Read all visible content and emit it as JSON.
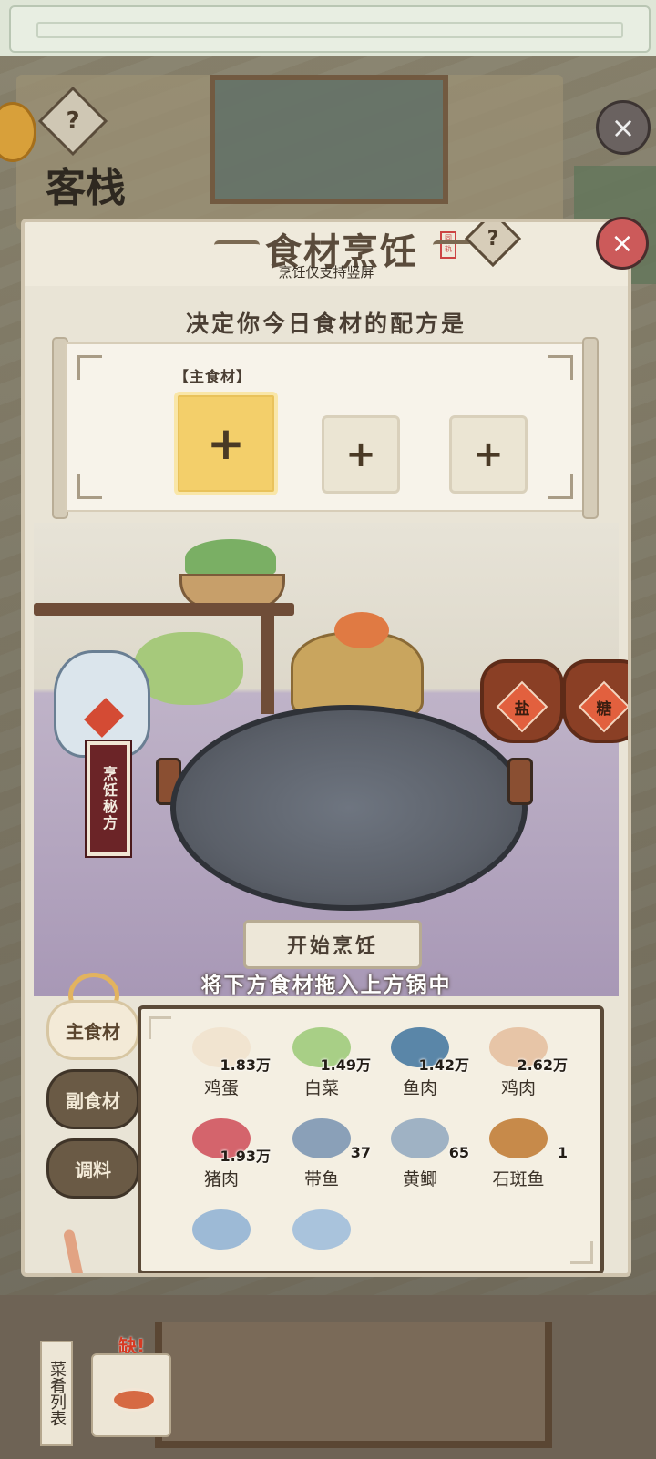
{
  "background": {
    "title": "客栈"
  },
  "panel": {
    "title": "食材烹饪",
    "title_seal": "同轨",
    "subnote": "烹饪仅支持竖屏",
    "prompt": "决定你今日食材的配方是",
    "main_label": "【主食材】",
    "slot_plus": "+",
    "secret_recipe": "烹饪秘方",
    "start_button": "开始烹饪",
    "drag_hint": "将下方食材拖入上方锅中",
    "jars": [
      "盐",
      "糖"
    ]
  },
  "tabs": [
    {
      "label": "主食材",
      "active": true
    },
    {
      "label": "副食材",
      "active": false
    },
    {
      "label": "调料",
      "active": false
    }
  ],
  "ingredients": [
    {
      "name": "鸡蛋",
      "count": "1.83万",
      "icon": "egg-icon",
      "color": "#f1e4d0"
    },
    {
      "name": "白菜",
      "count": "1.49万",
      "icon": "cabbage-icon",
      "color": "#a8cf86"
    },
    {
      "name": "鱼肉",
      "count": "1.42万",
      "icon": "fish-meat-icon",
      "color": "#5a86a8"
    },
    {
      "name": "鸡肉",
      "count": "2.62万",
      "icon": "chicken-icon",
      "color": "#e7c5a7"
    },
    {
      "name": "猪肉",
      "count": "1.93万",
      "icon": "pork-icon",
      "color": "#d4646c"
    },
    {
      "name": "带鱼",
      "count": "37",
      "icon": "hairtail-icon",
      "color": "#8aa0b8"
    },
    {
      "name": "黄鲫",
      "count": "65",
      "icon": "yellow-fish-icon",
      "color": "#9fb2c4"
    },
    {
      "name": "石斑鱼",
      "count": "1",
      "icon": "grouper-icon",
      "color": "#c78a4a"
    },
    {
      "name": "",
      "count": "",
      "icon": "fish-icon",
      "color": "#9dbad6"
    },
    {
      "name": "",
      "count": "",
      "icon": "fish-icon",
      "color": "#a9c3dc"
    }
  ],
  "bottom": {
    "dish_list": "菜肴列表",
    "lack": "缺!"
  },
  "icons": {
    "close": "×",
    "help": "?"
  }
}
